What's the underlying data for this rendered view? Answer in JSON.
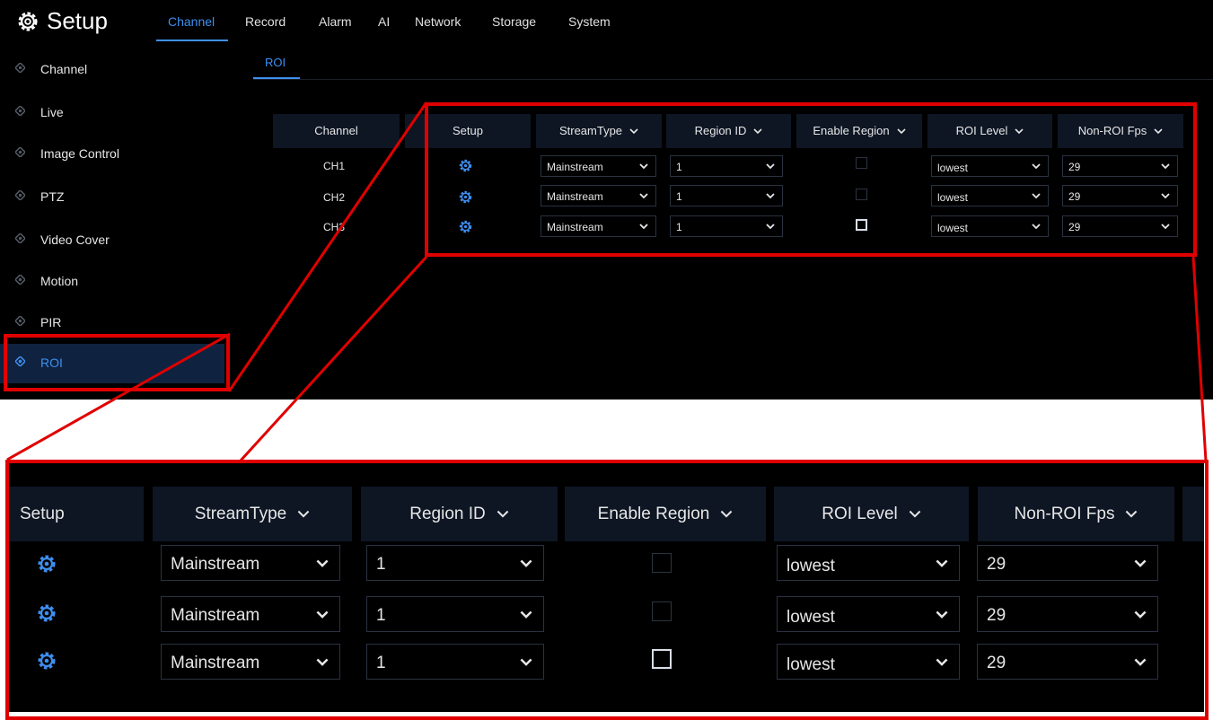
{
  "header": {
    "title": "Setup",
    "tabs": [
      "Channel",
      "Record",
      "Alarm",
      "AI",
      "Network",
      "Storage",
      "System"
    ],
    "active_tab": "Channel",
    "subtab": "ROI"
  },
  "sidebar": {
    "items": [
      {
        "label": "Channel"
      },
      {
        "label": "Live"
      },
      {
        "label": "Image Control"
      },
      {
        "label": "PTZ"
      },
      {
        "label": "Video Cover"
      },
      {
        "label": "Motion"
      },
      {
        "label": "PIR"
      },
      {
        "label": "ROI"
      }
    ],
    "active": "ROI"
  },
  "table": {
    "columns": [
      "Channel",
      "Setup",
      "StreamType",
      "Region ID",
      "Enable Region",
      "ROI Level",
      "Non-ROI Fps"
    ],
    "rows": [
      {
        "channel": "CH1",
        "stream": "Mainstream",
        "region": "1",
        "enabled": false,
        "level": "lowest",
        "fps": "29"
      },
      {
        "channel": "CH2",
        "stream": "Mainstream",
        "region": "1",
        "enabled": false,
        "level": "lowest",
        "fps": "29"
      },
      {
        "channel": "CH3",
        "stream": "Mainstream",
        "region": "1",
        "enabled": false,
        "level": "lowest",
        "fps": "29"
      }
    ]
  },
  "colors": {
    "accent": "#3e8ff0",
    "highlight": "#e00000",
    "background": "#000000"
  }
}
